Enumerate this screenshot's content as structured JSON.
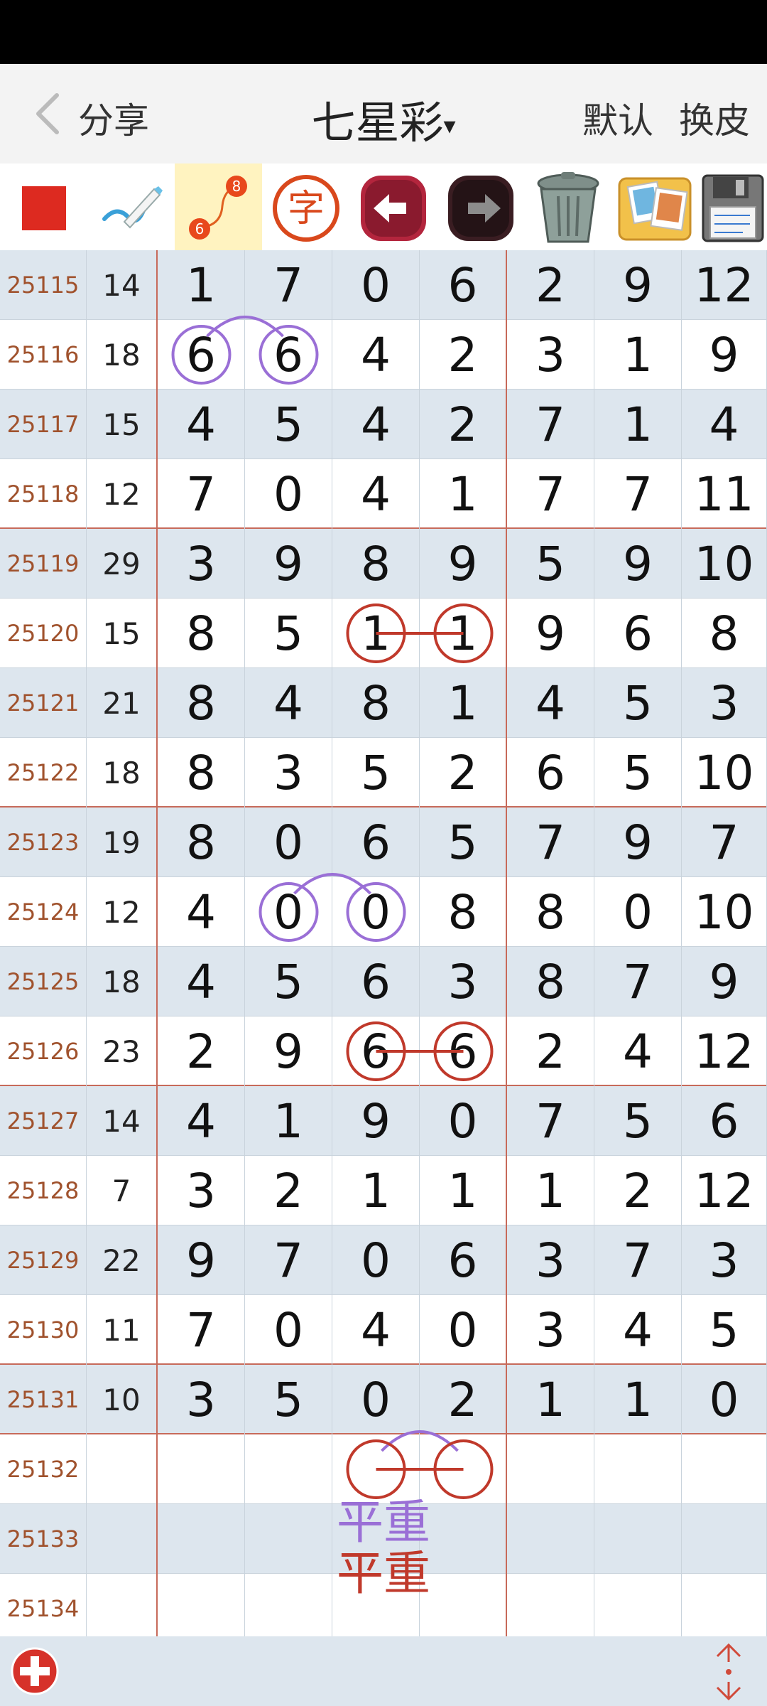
{
  "header": {
    "share_label": "分享",
    "title": "七星彩",
    "title_arrow": "▾",
    "default_label": "默认",
    "skin_label": "换皮"
  },
  "toolbar": {
    "items": [
      {
        "icon": "red-square-icon"
      },
      {
        "icon": "draw-pen-icon"
      },
      {
        "icon": "link-numbers-icon",
        "badge_top": "8",
        "badge_bottom": "6"
      },
      {
        "icon": "char-circle-icon",
        "glyph": "字"
      },
      {
        "icon": "undo-arrow-icon"
      },
      {
        "icon": "redo-arrow-icon"
      },
      {
        "icon": "trash-icon"
      },
      {
        "icon": "photo-album-icon"
      },
      {
        "icon": "save-disk-icon"
      }
    ]
  },
  "rows": [
    {
      "issue": "25115",
      "sum": "14",
      "digits": [
        "1",
        "7",
        "0",
        "6",
        "2",
        "9",
        "12"
      ]
    },
    {
      "issue": "25116",
      "sum": "18",
      "digits": [
        "6",
        "6",
        "4",
        "2",
        "3",
        "1",
        "9"
      ]
    },
    {
      "issue": "25117",
      "sum": "15",
      "digits": [
        "4",
        "5",
        "4",
        "2",
        "7",
        "1",
        "4"
      ]
    },
    {
      "issue": "25118",
      "sum": "12",
      "digits": [
        "7",
        "0",
        "4",
        "1",
        "7",
        "7",
        "11"
      ]
    },
    {
      "issue": "25119",
      "sum": "29",
      "digits": [
        "3",
        "9",
        "8",
        "9",
        "5",
        "9",
        "10"
      ]
    },
    {
      "issue": "25120",
      "sum": "15",
      "digits": [
        "8",
        "5",
        "1",
        "1",
        "9",
        "6",
        "8"
      ]
    },
    {
      "issue": "25121",
      "sum": "21",
      "digits": [
        "8",
        "4",
        "8",
        "1",
        "4",
        "5",
        "3"
      ]
    },
    {
      "issue": "25122",
      "sum": "18",
      "digits": [
        "8",
        "3",
        "5",
        "2",
        "6",
        "5",
        "10"
      ]
    },
    {
      "issue": "25123",
      "sum": "19",
      "digits": [
        "8",
        "0",
        "6",
        "5",
        "7",
        "9",
        "7"
      ]
    },
    {
      "issue": "25124",
      "sum": "12",
      "digits": [
        "4",
        "0",
        "0",
        "8",
        "8",
        "0",
        "10"
      ]
    },
    {
      "issue": "25125",
      "sum": "18",
      "digits": [
        "4",
        "5",
        "6",
        "3",
        "8",
        "7",
        "9"
      ]
    },
    {
      "issue": "25126",
      "sum": "23",
      "digits": [
        "2",
        "9",
        "6",
        "6",
        "2",
        "4",
        "12"
      ]
    },
    {
      "issue": "25127",
      "sum": "14",
      "digits": [
        "4",
        "1",
        "9",
        "0",
        "7",
        "5",
        "6"
      ]
    },
    {
      "issue": "25128",
      "sum": "7",
      "digits": [
        "3",
        "2",
        "1",
        "1",
        "1",
        "2",
        "12"
      ]
    },
    {
      "issue": "25129",
      "sum": "22",
      "digits": [
        "9",
        "7",
        "0",
        "6",
        "3",
        "7",
        "3"
      ]
    },
    {
      "issue": "25130",
      "sum": "11",
      "digits": [
        "7",
        "0",
        "4",
        "0",
        "3",
        "4",
        "5"
      ]
    },
    {
      "issue": "25131",
      "sum": "10",
      "digits": [
        "3",
        "5",
        "0",
        "2",
        "1",
        "1",
        "0"
      ]
    },
    {
      "issue": "25132",
      "sum": "",
      "digits": [
        "",
        "",
        "",
        "",
        "",
        "",
        ""
      ]
    },
    {
      "issue": "25133",
      "sum": "",
      "digits": [
        "",
        "",
        "",
        "",
        "",
        "",
        ""
      ]
    },
    {
      "issue": "25134",
      "sum": "",
      "digits": [
        "",
        "",
        "",
        "",
        "",
        "",
        ""
      ]
    }
  ],
  "annotations": {
    "purple_text": "平重",
    "red_text": "平重",
    "purple_color": "#9a6fd6",
    "red_color": "#c0392b"
  },
  "footer": {
    "add_icon": "plus-circle-icon",
    "scroll_icon": "up-down-arrows-icon"
  }
}
